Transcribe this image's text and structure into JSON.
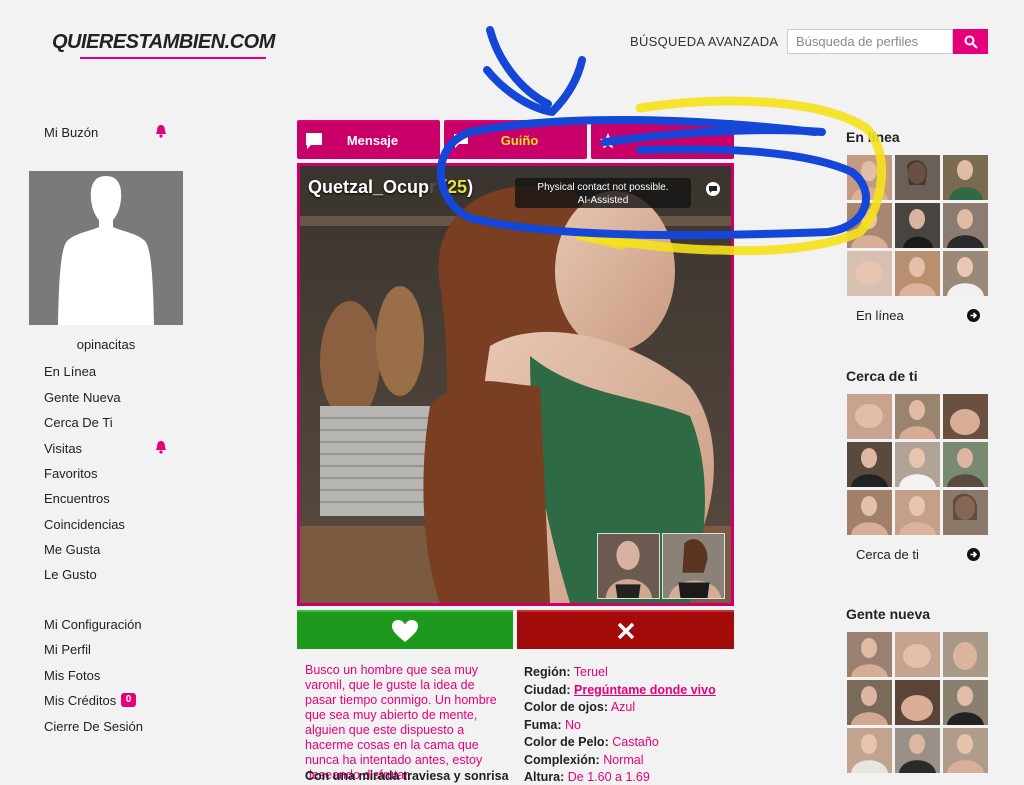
{
  "header": {
    "logo_text": "QUIERESTAMBIEN.COM",
    "advanced_search": "BÚSQUEDA AVANZADA",
    "search_placeholder": "Búsqueda de perfiles"
  },
  "sidebar": {
    "mailbox": "Mi Buzón",
    "username": "opinacitas",
    "nav": [
      "En Línea",
      "Gente Nueva",
      "Cerca De Ti",
      "Visitas",
      "Favoritos",
      "Encuentros",
      "Coincidencias",
      "Me Gusta",
      "Le Gusto"
    ],
    "account": [
      "Mi Configuración",
      "Mi Perfil",
      "Mis Fotos",
      "Mis Créditos",
      "Cierre De Sesión"
    ],
    "credits_count": "0"
  },
  "actions": {
    "message": "Mensaje",
    "wink": "Guiño",
    "favorite": ""
  },
  "profile": {
    "name": "Quetzal_Ocup",
    "name_hidden": "r",
    "age": "25",
    "ai_badge_line1": "Physical contact not possible.",
    "ai_badge_line2": "AI-Assisted",
    "description": "Busco un hombre que sea muy varonil, que le guste la idea de pasar tiempo conmigo. Un hombre que sea muy abierto de mente, alguien que este dispuesto a hacerme cosas en la cama que nunca ha intentado antes, estoy deseando disfrutar.",
    "description_end": "Con una mirada traviesa y sonrisa",
    "details": [
      {
        "key": "Región:",
        "value": "Teruel",
        "link": false
      },
      {
        "key": "Ciudad:",
        "value": "Pregúntame donde vivo",
        "link": true
      },
      {
        "key": "Color de ojos:",
        "value": "Azul",
        "link": false
      },
      {
        "key": "Fuma:",
        "value": "No",
        "link": false
      },
      {
        "key": "Color de Pelo:",
        "value": "Castaño",
        "link": false
      },
      {
        "key": "Complexión:",
        "value": "Normal",
        "link": false
      },
      {
        "key": "Altura:",
        "value": "De 1.60 a 1.69",
        "link": false
      }
    ]
  },
  "right_column": {
    "online_title": "En línea",
    "online_link": "En línea",
    "nearby_title": "Cerca de ti",
    "nearby_link": "Cerca de ti",
    "new_title": "Gente nueva"
  },
  "colors": {
    "brand": "#e5007a",
    "like": "#1d9a1d",
    "dislike": "#a30a0a",
    "scribble_blue": "#1446d8",
    "scribble_yellow": "#f5e21a"
  }
}
